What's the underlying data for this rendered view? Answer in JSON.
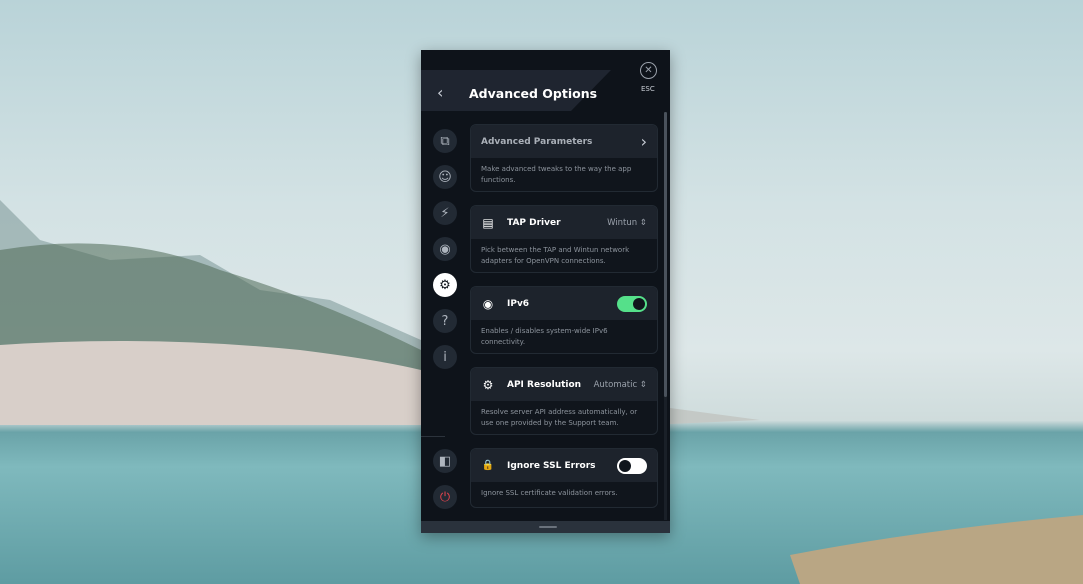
{
  "header": {
    "title": "Advanced Options",
    "back_icon": "chevron-left-icon",
    "close_icon": "close-icon",
    "close_label": "ESC"
  },
  "sidebar": {
    "items": [
      {
        "id": "split-tunneling",
        "icon": "split-icon",
        "glyph": "⧉"
      },
      {
        "id": "account",
        "icon": "user-icon",
        "glyph": "☺"
      },
      {
        "id": "connection",
        "icon": "plug-icon",
        "glyph": "⚡"
      },
      {
        "id": "robert",
        "icon": "shield-icon",
        "glyph": "◉"
      },
      {
        "id": "settings",
        "icon": "gear-icon",
        "glyph": "⚙",
        "active": true
      },
      {
        "id": "help",
        "icon": "question-icon",
        "glyph": "?"
      },
      {
        "id": "about",
        "icon": "info-icon",
        "glyph": "i"
      },
      {
        "id": "logout",
        "icon": "door-icon",
        "glyph": "◧"
      },
      {
        "id": "quit",
        "icon": "power-icon",
        "glyph": "⏻"
      }
    ]
  },
  "cards": [
    {
      "title": "Advanced Parameters",
      "description": "Make advanced tweaks to the way the app functions.",
      "control": "chevron",
      "glyph": "›"
    },
    {
      "title": "TAP Driver",
      "icon": "server-icon",
      "glyph": "▤",
      "value": "Wintun",
      "description": "Pick between the TAP and Wintun network adapters for OpenVPN connections.",
      "control": "select"
    },
    {
      "title": "IPv6",
      "icon": "ipv6-icon",
      "glyph": "◉",
      "description": "Enables / disables system-wide IPv6 connectivity.",
      "control": "toggle",
      "enabled": true
    },
    {
      "title": "API Resolution",
      "icon": "gear-icon",
      "glyph": "⚙",
      "value": "Automatic",
      "description": "Resolve server API address automatically, or use one provided by the Support team.",
      "control": "select"
    },
    {
      "title": "Ignore SSL Errors",
      "icon": "lock-warning-icon",
      "glyph": "🔒",
      "description": "Ignore SSL certificate validation errors.",
      "control": "toggle",
      "enabled": false
    }
  ],
  "colors": {
    "accent": "#55e08a",
    "panel": "#0e131a",
    "power": "#e0434d"
  }
}
